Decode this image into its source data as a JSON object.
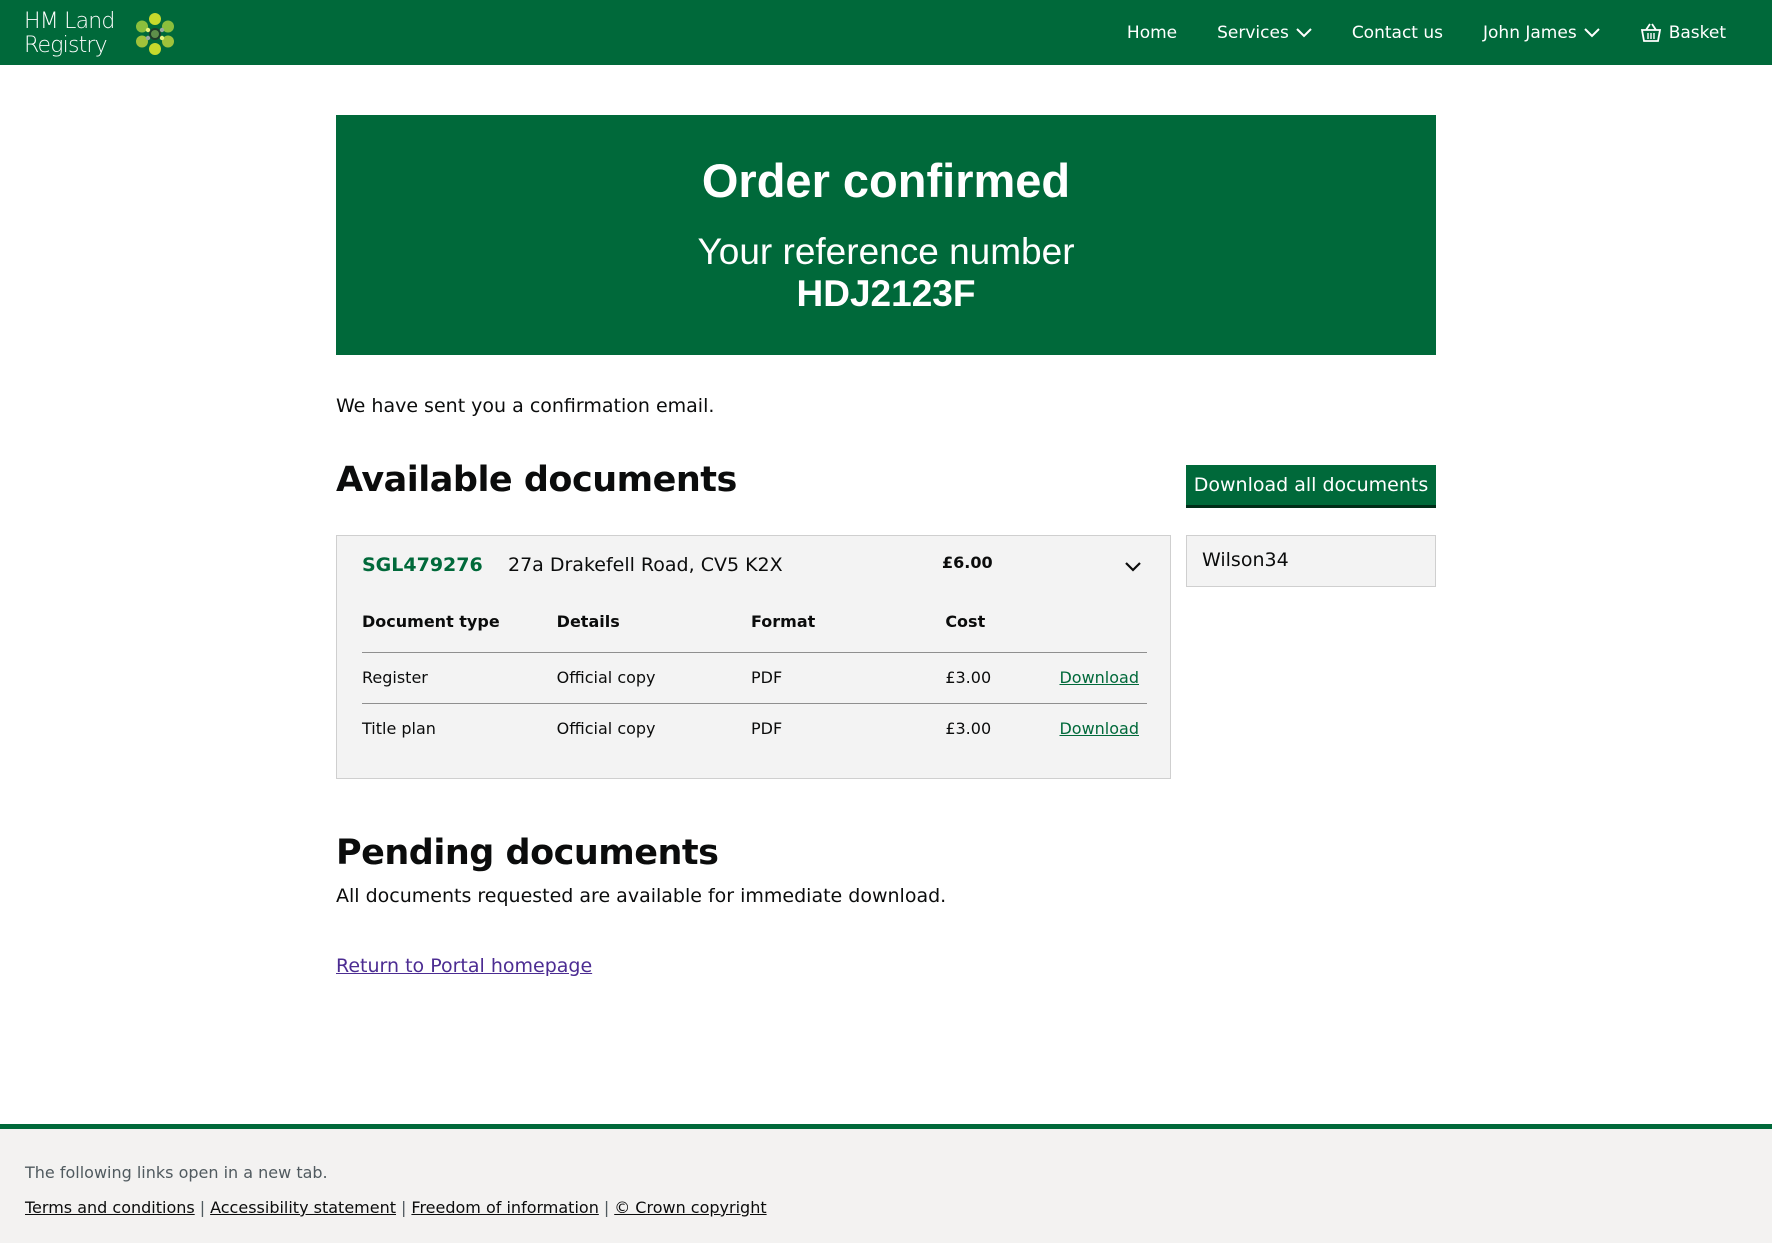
{
  "header": {
    "logo_line1": "HM Land",
    "logo_line2": "Registry",
    "nav": {
      "home": "Home",
      "services": "Services",
      "contact": "Contact us",
      "user": "John James",
      "basket": "Basket"
    }
  },
  "banner": {
    "title": "Order confirmed",
    "ref_label": "Your reference number",
    "ref_value": "HDJ2123F"
  },
  "confirmation_text": "We have sent you a confirmation email.",
  "available": {
    "title": "Available documents",
    "download_all_label": "Download all documents",
    "title_number": "SGL479276",
    "address": "27a Drakefell Road, CV5 K2X",
    "price": "£6.00",
    "reference": "Wilson34",
    "columns": [
      "Document type",
      "Details",
      "Format",
      "Cost"
    ],
    "rows": [
      {
        "type": "Register",
        "details": "Official copy",
        "format": "PDF",
        "cost": "£3.00",
        "action": "Download"
      },
      {
        "type": "Title plan",
        "details": "Official copy",
        "format": "PDF",
        "cost": "£3.00",
        "action": "Download"
      }
    ]
  },
  "pending": {
    "title": "Pending documents",
    "text": "All documents requested are available for immediate download."
  },
  "return_link": "Return to Portal homepage",
  "footer": {
    "note": "The following links open in a new tab.",
    "links": [
      "Terms and conditions",
      "Accessibility statement",
      "Freedom of information",
      "© Crown copyright"
    ]
  },
  "colors": {
    "brand_green": "#00693a",
    "link_purple": "#4c2c92"
  }
}
